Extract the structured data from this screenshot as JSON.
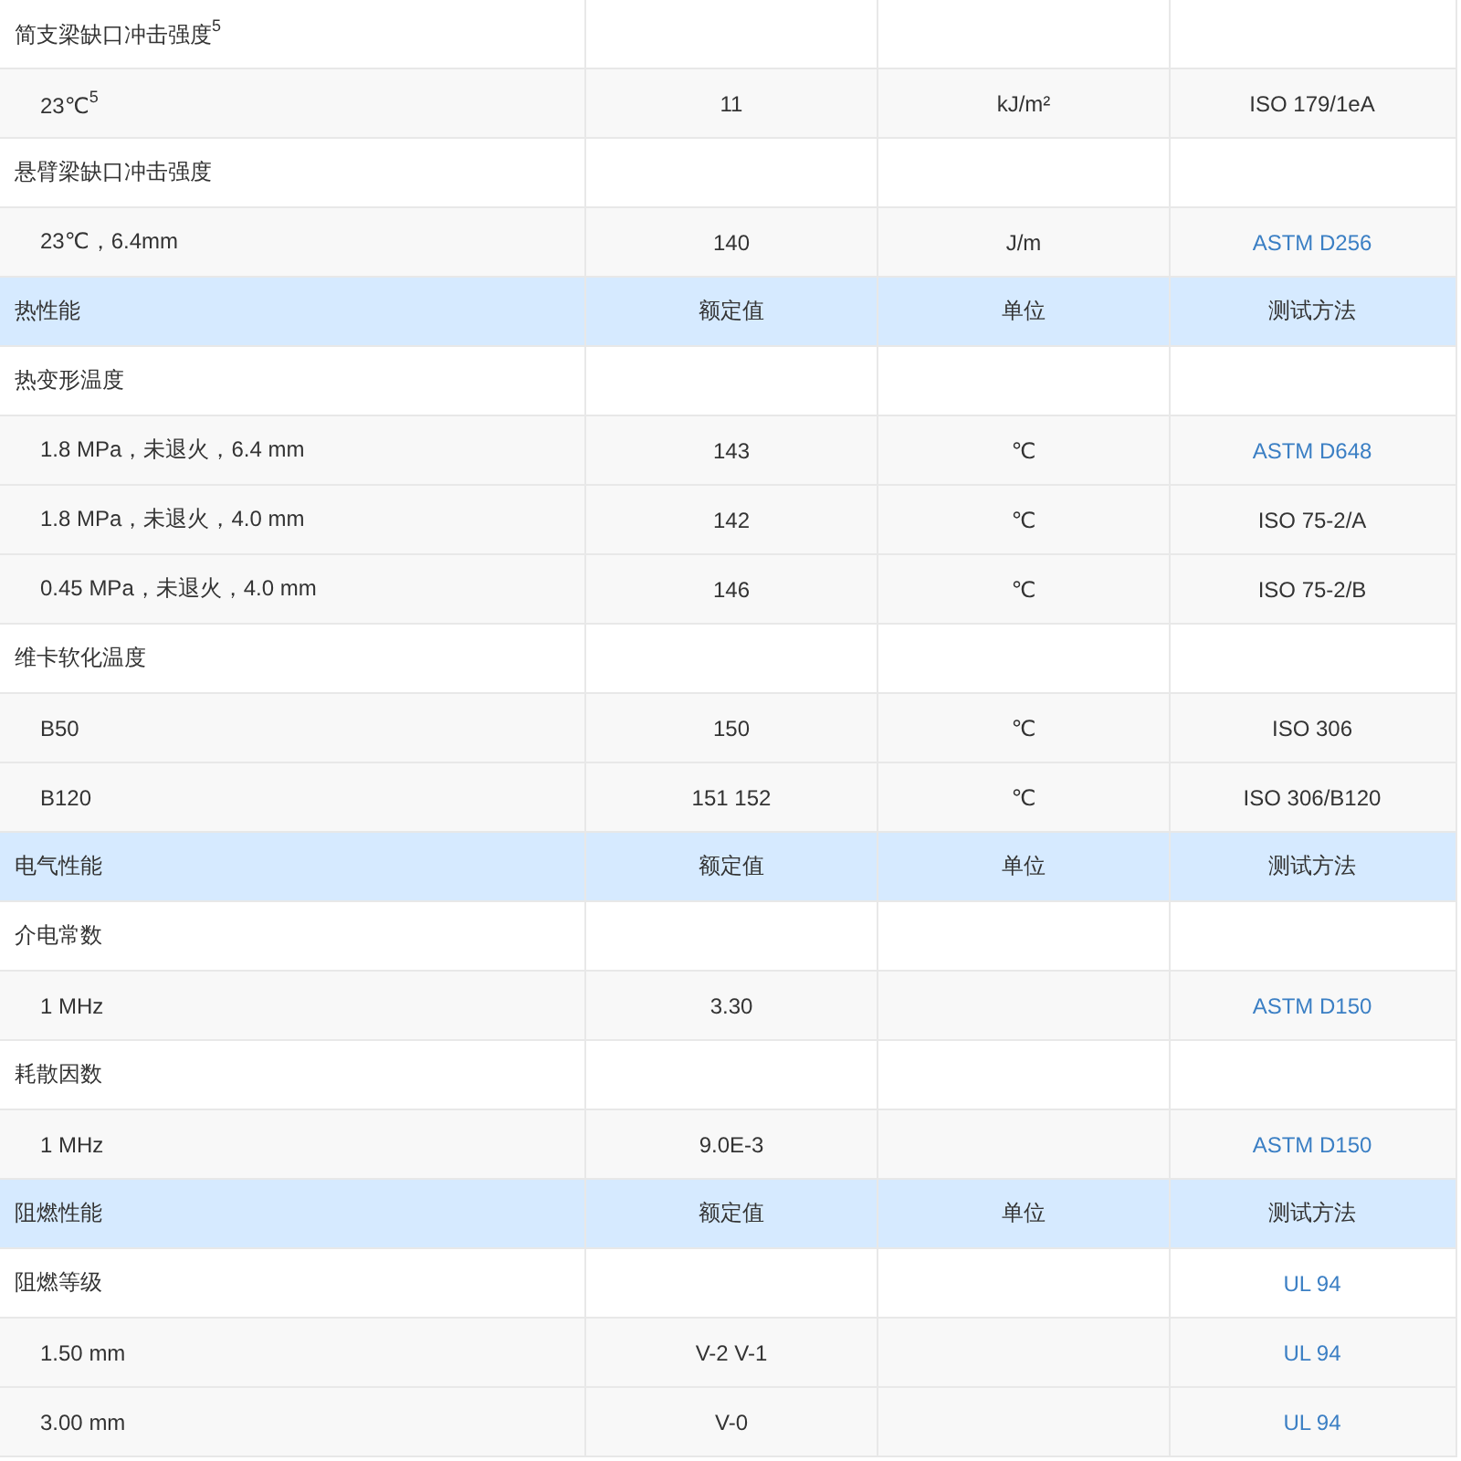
{
  "rows": [
    {
      "kind": "group",
      "name": "简支梁缺口冲击强度$^{5}$"
    },
    {
      "kind": "item",
      "name": "23℃$^{5}$",
      "value": "11",
      "unit": "kJ/m²",
      "method": "ISO 179/1eA",
      "link": false
    },
    {
      "kind": "group",
      "name": "悬臂梁缺口冲击强度"
    },
    {
      "kind": "item",
      "name": "23℃，6.4mm",
      "value": "140",
      "unit": "J/m",
      "method": "ASTM D256",
      "link": true
    },
    {
      "kind": "header",
      "name": "热性能",
      "value": "额定值",
      "unit": "单位",
      "method": "测试方法"
    },
    {
      "kind": "group",
      "name": "热变形温度"
    },
    {
      "kind": "item",
      "name": "1.8 MPa，未退火，6.4 mm",
      "value": "143",
      "unit": "℃",
      "method": "ASTM D648",
      "link": true
    },
    {
      "kind": "item",
      "name": "1.8 MPa，未退火，4.0 mm",
      "value": "142",
      "unit": "℃",
      "method": "ISO 75-2/A",
      "link": false
    },
    {
      "kind": "item",
      "name": "0.45 MPa，未退火，4.0 mm",
      "value": "146",
      "unit": "℃",
      "method": "ISO 75-2/B",
      "link": false
    },
    {
      "kind": "group",
      "name": "维卡软化温度"
    },
    {
      "kind": "item",
      "name": "B50",
      "value": "150",
      "unit": "℃",
      "method": "ISO 306",
      "link": false
    },
    {
      "kind": "item",
      "name": "B120",
      "value": "151 152",
      "unit": "℃",
      "method": "ISO 306/B120",
      "link": false
    },
    {
      "kind": "header",
      "name": "电气性能",
      "value": "额定值",
      "unit": "单位",
      "method": "测试方法"
    },
    {
      "kind": "group",
      "name": "介电常数"
    },
    {
      "kind": "item",
      "name": "1 MHz",
      "value": "3.30",
      "method": "ASTM D150",
      "link": true
    },
    {
      "kind": "group",
      "name": "耗散因数"
    },
    {
      "kind": "item",
      "name": "1 MHz",
      "value": "9.0E-3",
      "method": "ASTM D150",
      "link": true
    },
    {
      "kind": "header",
      "name": "阻燃性能",
      "value": "额定值",
      "unit": "单位",
      "method": "测试方法"
    },
    {
      "kind": "group",
      "name": "阻燃等级",
      "method": "UL 94",
      "link": true
    },
    {
      "kind": "item",
      "name": "1.50 mm",
      "value": "V-2 V-1",
      "method": "UL 94",
      "link": true
    },
    {
      "kind": "item",
      "name": "3.00 mm",
      "value": "V-0",
      "method": "UL 94",
      "link": true
    }
  ]
}
